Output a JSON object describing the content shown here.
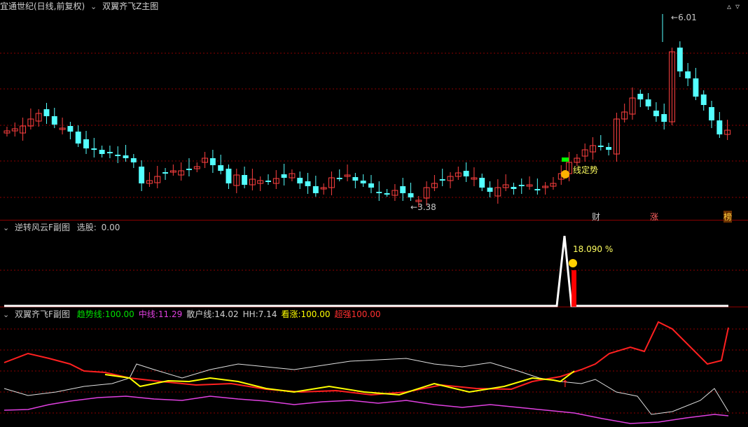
{
  "main_panel": {
    "stock_name": "宜通世纪(日线,前复权)",
    "indicator": "双翼齐飞Z主图",
    "high_label": "6.01",
    "low_label": "3.38",
    "signal_label": "线定势",
    "markers": [
      "财",
      "涨",
      "榜"
    ]
  },
  "sub_panel_1": {
    "title": "逆转风云F副图",
    "xuangu_label": "选股:",
    "xuangu_value": "0.00",
    "peak_value": "18.090",
    "peak_unit": "%"
  },
  "sub_panel_2": {
    "title": "双翼齐飞F副图",
    "items": [
      {
        "label": "趋势线:",
        "value": "100.00",
        "color": "#00e000"
      },
      {
        "label": "中线:",
        "value": "11.29",
        "color": "#e040e0"
      },
      {
        "label": "散户线:",
        "value": "14.02",
        "color": "#d0d0d0"
      },
      {
        "label": "HH:",
        "value": "7.14",
        "color": "#d0d0d0"
      },
      {
        "label": "看涨:",
        "value": "100.00",
        "color": "#ffff00"
      },
      {
        "label": "超强",
        "value": "100.00",
        "color": "#ff3030"
      }
    ]
  },
  "colors": {
    "up": "#ff4040",
    "down": "#54ffff",
    "separator": "#8b0000",
    "grid": "#8b0000"
  }
}
